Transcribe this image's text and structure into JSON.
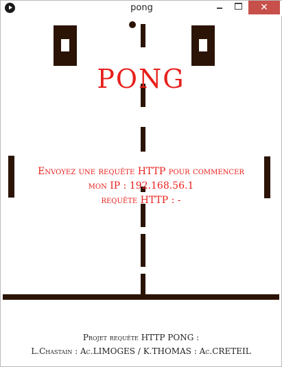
{
  "window": {
    "title": "pong",
    "controls": {
      "minimize": "minimize",
      "maximize": "maximize",
      "close": "✕"
    }
  },
  "game": {
    "title": "PONG",
    "message_line1": "Envoyez une requête HTTP pour commencer",
    "message_line2": "mon IP : 192.168.56.1",
    "message_line3": "requête HTTP : -",
    "credit_line1": "Projet requête HTTP PONG :",
    "credit_line2": "L.Chastain : Ac.LIMOGES / K.THOMAS : Ac.CRETEIL",
    "colors": {
      "text_accent": "#e8201c",
      "objects": "#2b1405",
      "background": "#ffffff"
    }
  }
}
